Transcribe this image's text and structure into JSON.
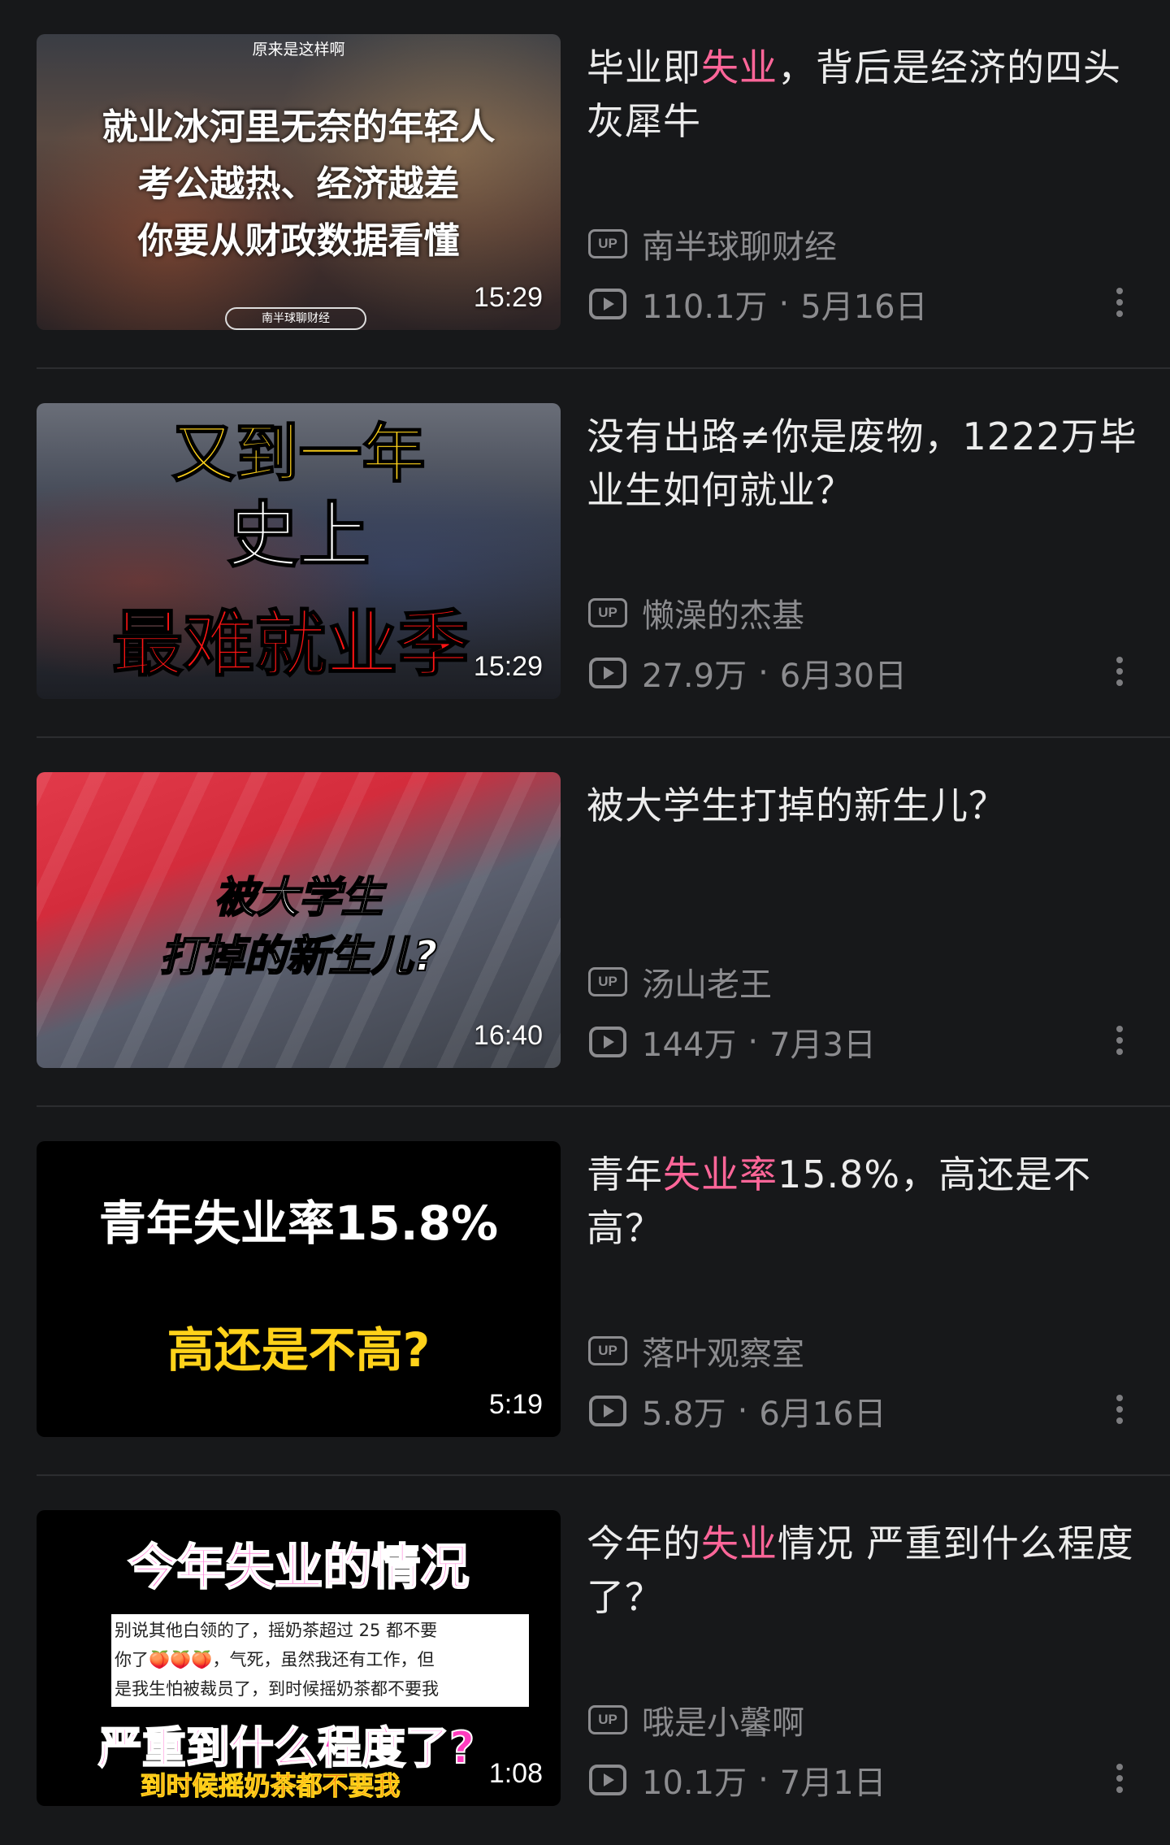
{
  "videos": [
    {
      "title_before": "毕业即",
      "title_highlight": "失业",
      "title_after": "，背后是经济的四头灰犀牛",
      "uploader": "南半球聊财经",
      "views": "110.1万",
      "date": "5月16日",
      "duration": "15:29",
      "thumb_lines": [
        "原来是这样啊",
        "就业冰河里无奈的年轻人",
        "考公越热、经济越差",
        "你要从财政数据看懂",
        "南半球聊财经"
      ]
    },
    {
      "title_before": "没有出路≠你是废物，1222万毕业生如何就业？",
      "title_highlight": "",
      "title_after": "",
      "uploader": "懒澡的杰基",
      "views": "27.9万",
      "date": "6月30日",
      "duration": "15:29",
      "thumb_lines": [
        "又到一年",
        "史上",
        "最难就业季"
      ]
    },
    {
      "title_before": "被大学生打掉的新生儿？",
      "title_highlight": "",
      "title_after": "",
      "uploader": "汤山老王",
      "views": "144万",
      "date": "7月3日",
      "duration": "16:40",
      "thumb_lines": [
        "被大学生",
        "打掉的新生儿?"
      ]
    },
    {
      "title_before": "青年",
      "title_highlight": "失业率",
      "title_after": "15.8%，高还是不高？",
      "uploader": "落叶观察室",
      "views": "5.8万",
      "date": "6月16日",
      "duration": "5:19",
      "thumb_lines": [
        "青年失业率15.8%",
        "高还是不高?"
      ]
    },
    {
      "title_before": "今年的",
      "title_highlight": "失业",
      "title_after": "情况 严重到什么程度了？",
      "uploader": "哦是小馨啊",
      "views": "10.1万",
      "date": "7月1日",
      "duration": "1:08",
      "thumb_lines": [
        "今年失业的情况",
        "别说其他白领的了，摇奶茶超过 25 都不要",
        "你了🍑🍑🍑，气死，虽然我还有工作，但",
        "是我生怕被裁员了，到时候摇奶茶都不要我",
        "严重到什么程度了?",
        "到时候摇奶茶都不要我"
      ]
    }
  ],
  "labels": {
    "up_badge": "UP",
    "separator": "·"
  },
  "colors": {
    "background": "#17181a",
    "highlight": "#ff6699",
    "meta": "#8c8c8f"
  }
}
